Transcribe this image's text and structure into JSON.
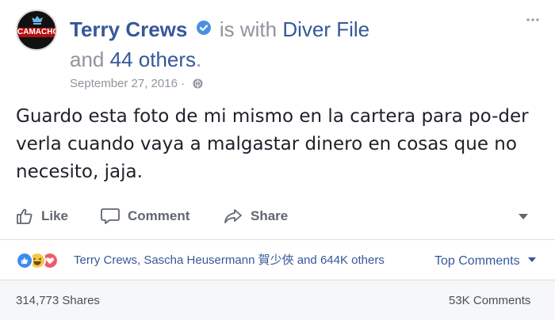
{
  "post": {
    "author": "Terry Crews",
    "with_text": "is with",
    "tagged_user": "Diver File",
    "and_text": "and",
    "others_link": "44 others",
    "period": ".",
    "date": "September 27, 2016",
    "date_separator": "·",
    "avatar_logo_text": "CAMACHO",
    "text": "Guardo esta foto de mi mismo en la cartera para po-der verla cuando vaya a malgastar dinero en cosas que no necesito, jaja."
  },
  "actions": {
    "like_label": "Like",
    "comment_label": "Comment",
    "share_label": "Share"
  },
  "reactions": {
    "names": "Terry Crews, Sascha Heusermann 賀少俠 and 644K others",
    "top_comments_label": "Top Comments",
    "types": [
      "like-icon",
      "haha-icon",
      "love-icon"
    ]
  },
  "stats": {
    "shares": "314,773 Shares",
    "comments": "53K Comments"
  },
  "colors": {
    "link": "#365899",
    "secondary_text": "#90949c",
    "like_blue": "#3b8cf5",
    "haha_yellow": "#f7c844",
    "love_red": "#f05a6a"
  }
}
